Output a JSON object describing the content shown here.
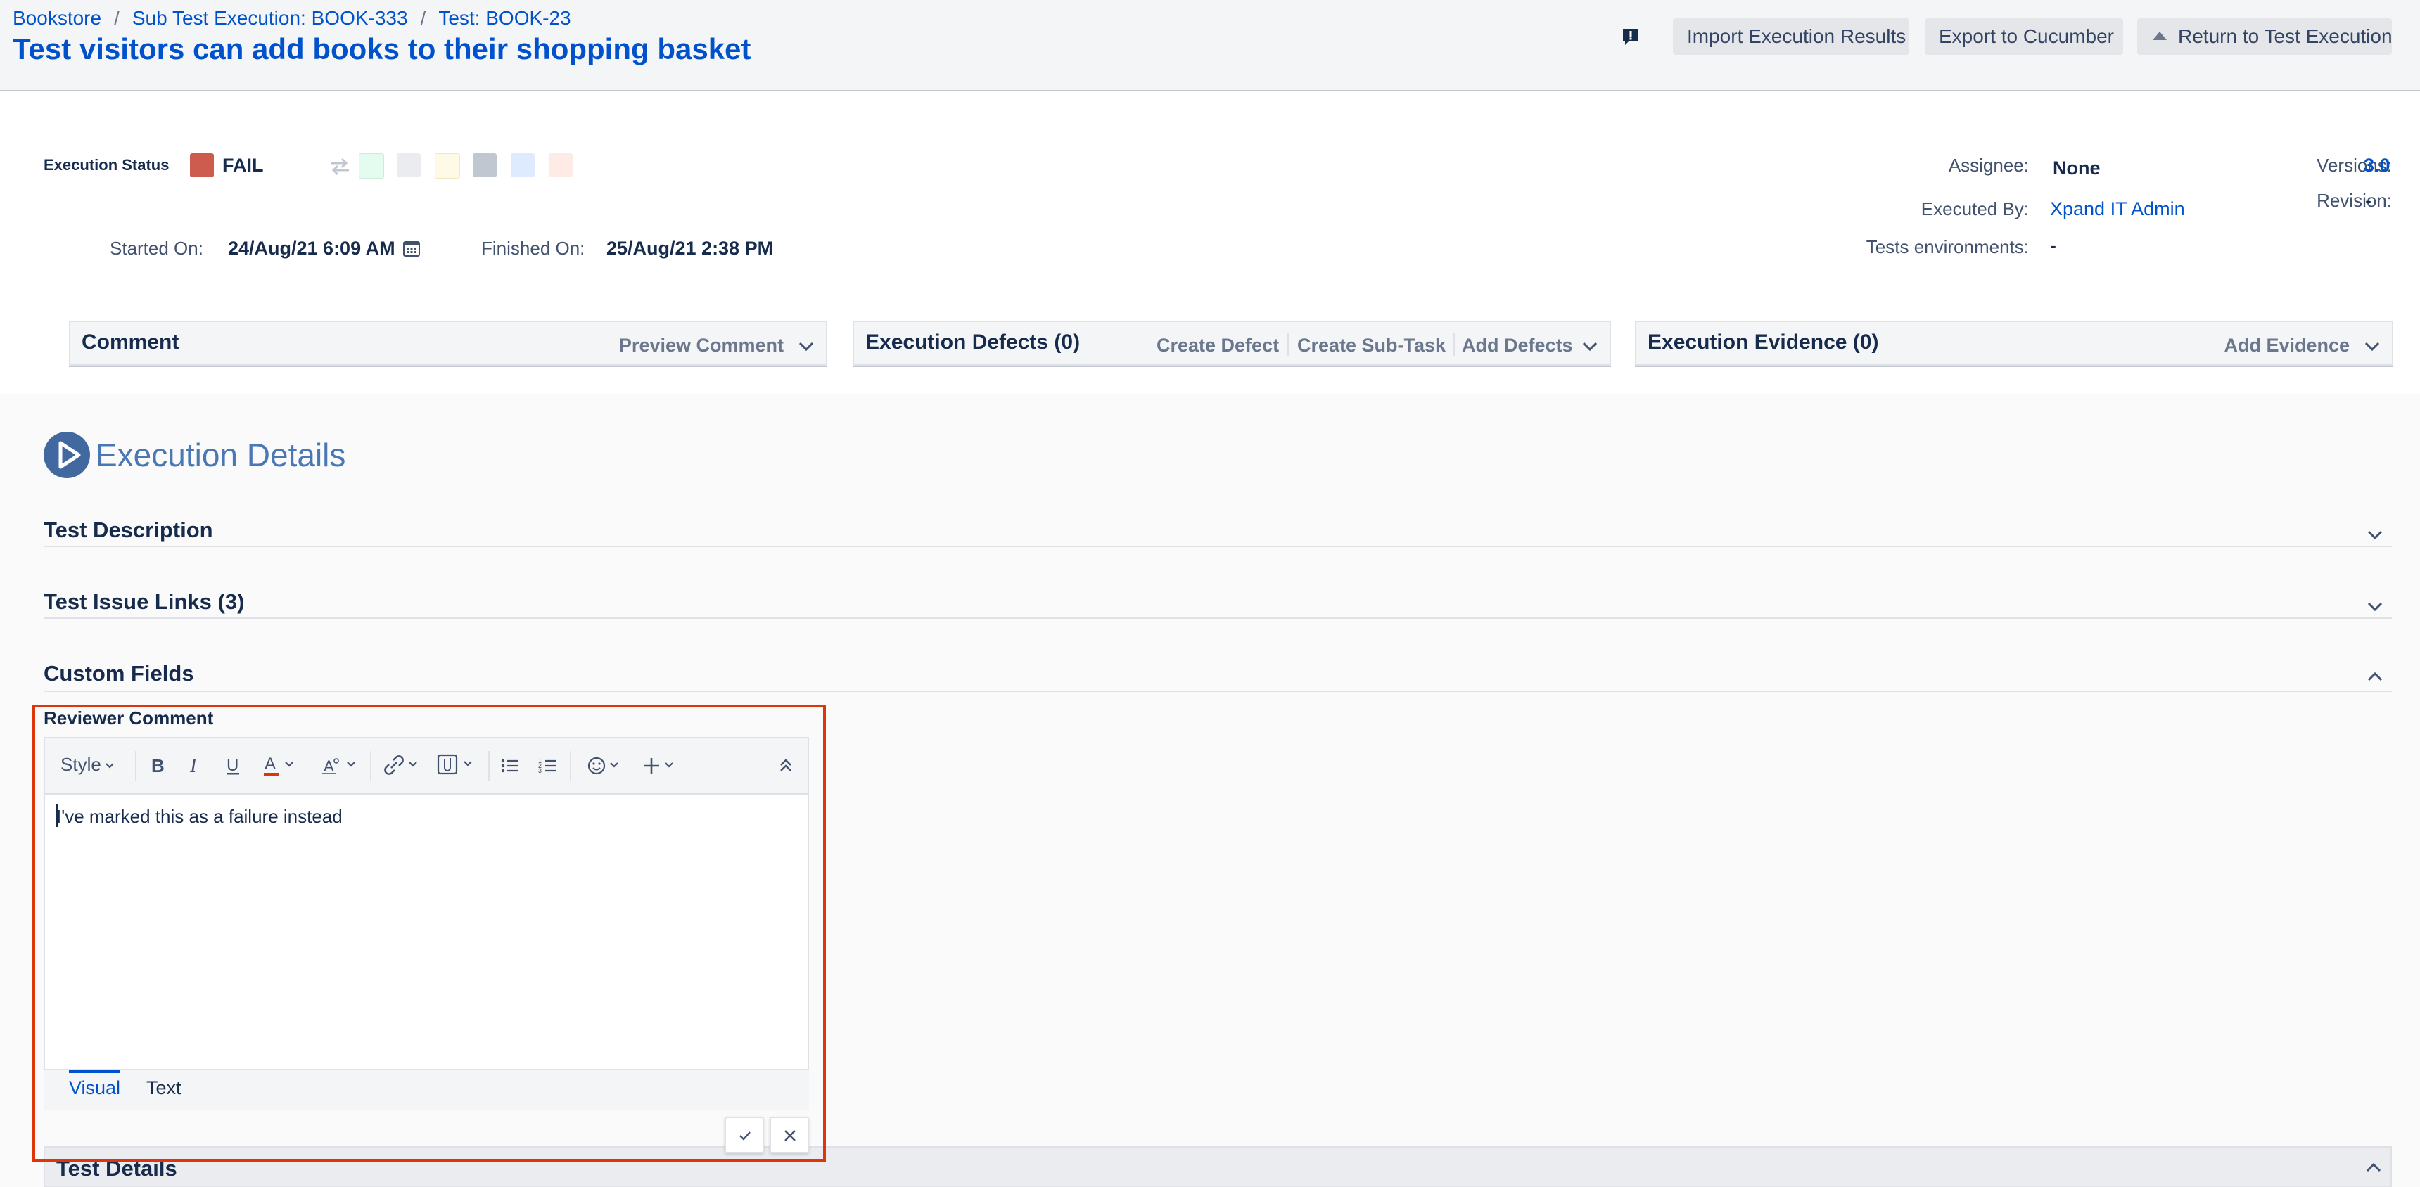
{
  "breadcrumb": {
    "items": [
      "Bookstore",
      "Sub Test Execution: BOOK-333",
      "Test: BOOK-23"
    ],
    "separator": "/"
  },
  "page_title": "Test visitors can add books to their shopping basket",
  "header_buttons": {
    "import": "Import Execution Results",
    "export": "Export to Cucumber",
    "return": "Return to Test Execution"
  },
  "execution": {
    "status_label": "Execution Status",
    "status_value": "FAIL",
    "status_color": "#cd5c4f",
    "status_options_colors": [
      "#e3fcef",
      "#ebecf0",
      "#fffae6",
      "#c1c7d0",
      "#deebff",
      "#ffebe6"
    ],
    "started_label": "Started On:",
    "started_value": "24/Aug/21 6:09 AM",
    "finished_label": "Finished On:",
    "finished_value": "25/Aug/21 2:38 PM"
  },
  "meta": {
    "assignee_label": "Assignee:",
    "assignee_value": "None",
    "executed_by_label": "Executed By:",
    "executed_by_value": "Xpand IT Admin",
    "environments_label": "Tests environments:",
    "environments_value": "-",
    "versions_label": "Versions:",
    "versions_value": "3.0",
    "revision_label": "Revision:",
    "revision_value": "-"
  },
  "panels": {
    "comment": {
      "title": "Comment",
      "action": "Preview Comment"
    },
    "defects": {
      "title": "Execution Defects (0)",
      "actions": [
        "Create Defect",
        "Create Sub-Task",
        "Add Defects"
      ]
    },
    "evidence": {
      "title": "Execution Evidence (0)",
      "action": "Add Evidence"
    }
  },
  "details": {
    "title": "Execution Details",
    "sections": [
      "Test Description",
      "Test Issue Links (3)",
      "Custom Fields"
    ],
    "test_details": "Test Details"
  },
  "reviewer_comment": {
    "label": "Reviewer Comment",
    "style_label": "Style",
    "text": "I've marked this as a failure instead",
    "tabs": [
      "Visual",
      "Text"
    ]
  },
  "colors": {
    "brand": "#0052cc",
    "fail": "#cd5c4f",
    "highlight": "#de350b"
  }
}
